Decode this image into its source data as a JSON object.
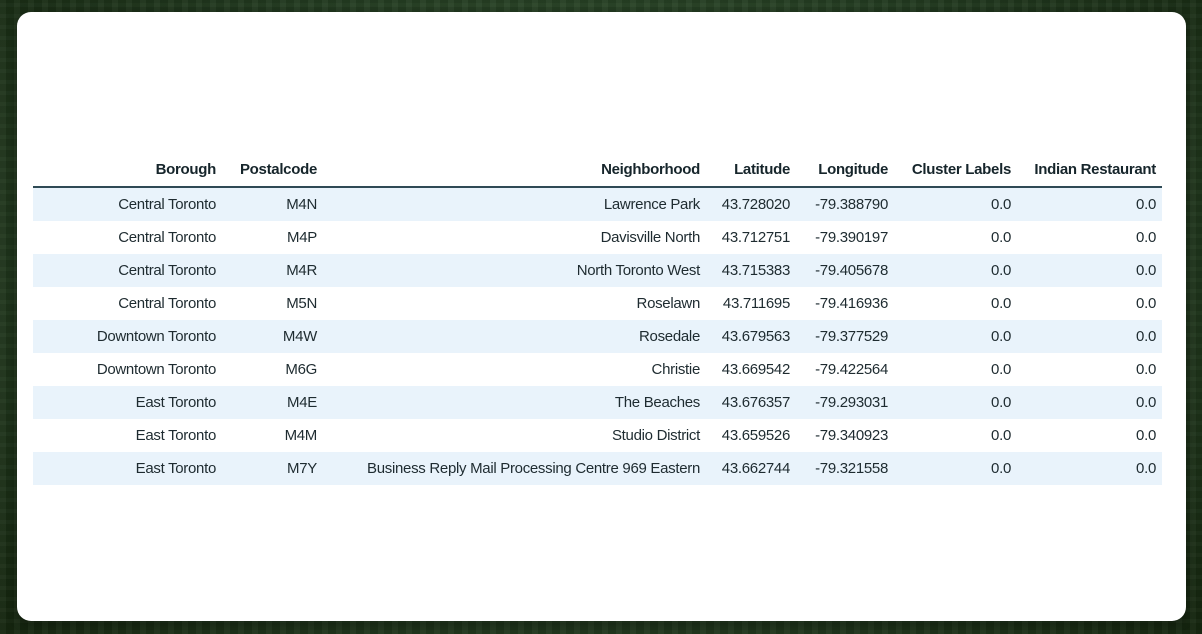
{
  "table": {
    "columns": [
      "Borough",
      "Postalcode",
      "Neighborhood",
      "Latitude",
      "Longitude",
      "Cluster Labels",
      "Indian Restaurant"
    ],
    "rows": [
      [
        "Central Toronto",
        "M4N",
        "Lawrence Park",
        "43.728020",
        "-79.388790",
        "0.0",
        "0.0"
      ],
      [
        "Central Toronto",
        "M4P",
        "Davisville North",
        "43.712751",
        "-79.390197",
        "0.0",
        "0.0"
      ],
      [
        "Central Toronto",
        "M4R",
        "North Toronto West",
        "43.715383",
        "-79.405678",
        "0.0",
        "0.0"
      ],
      [
        "Central Toronto",
        "M5N",
        "Roselawn",
        "43.711695",
        "-79.416936",
        "0.0",
        "0.0"
      ],
      [
        "Downtown Toronto",
        "M4W",
        "Rosedale",
        "43.679563",
        "-79.377529",
        "0.0",
        "0.0"
      ],
      [
        "Downtown Toronto",
        "M6G",
        "Christie",
        "43.669542",
        "-79.422564",
        "0.0",
        "0.0"
      ],
      [
        "East Toronto",
        "M4E",
        "The Beaches",
        "43.676357",
        "-79.293031",
        "0.0",
        "0.0"
      ],
      [
        "East Toronto",
        "M4M",
        "Studio District",
        "43.659526",
        "-79.340923",
        "0.0",
        "0.0"
      ],
      [
        "East Toronto",
        "M7Y",
        "Business Reply Mail Processing Centre 969 Eastern",
        "43.662744",
        "-79.321558",
        "0.0",
        "0.0"
      ]
    ]
  },
  "colors": {
    "stripe": "#e9f3fb",
    "header_rule": "#2f4a55",
    "text": "#1e2b30"
  }
}
